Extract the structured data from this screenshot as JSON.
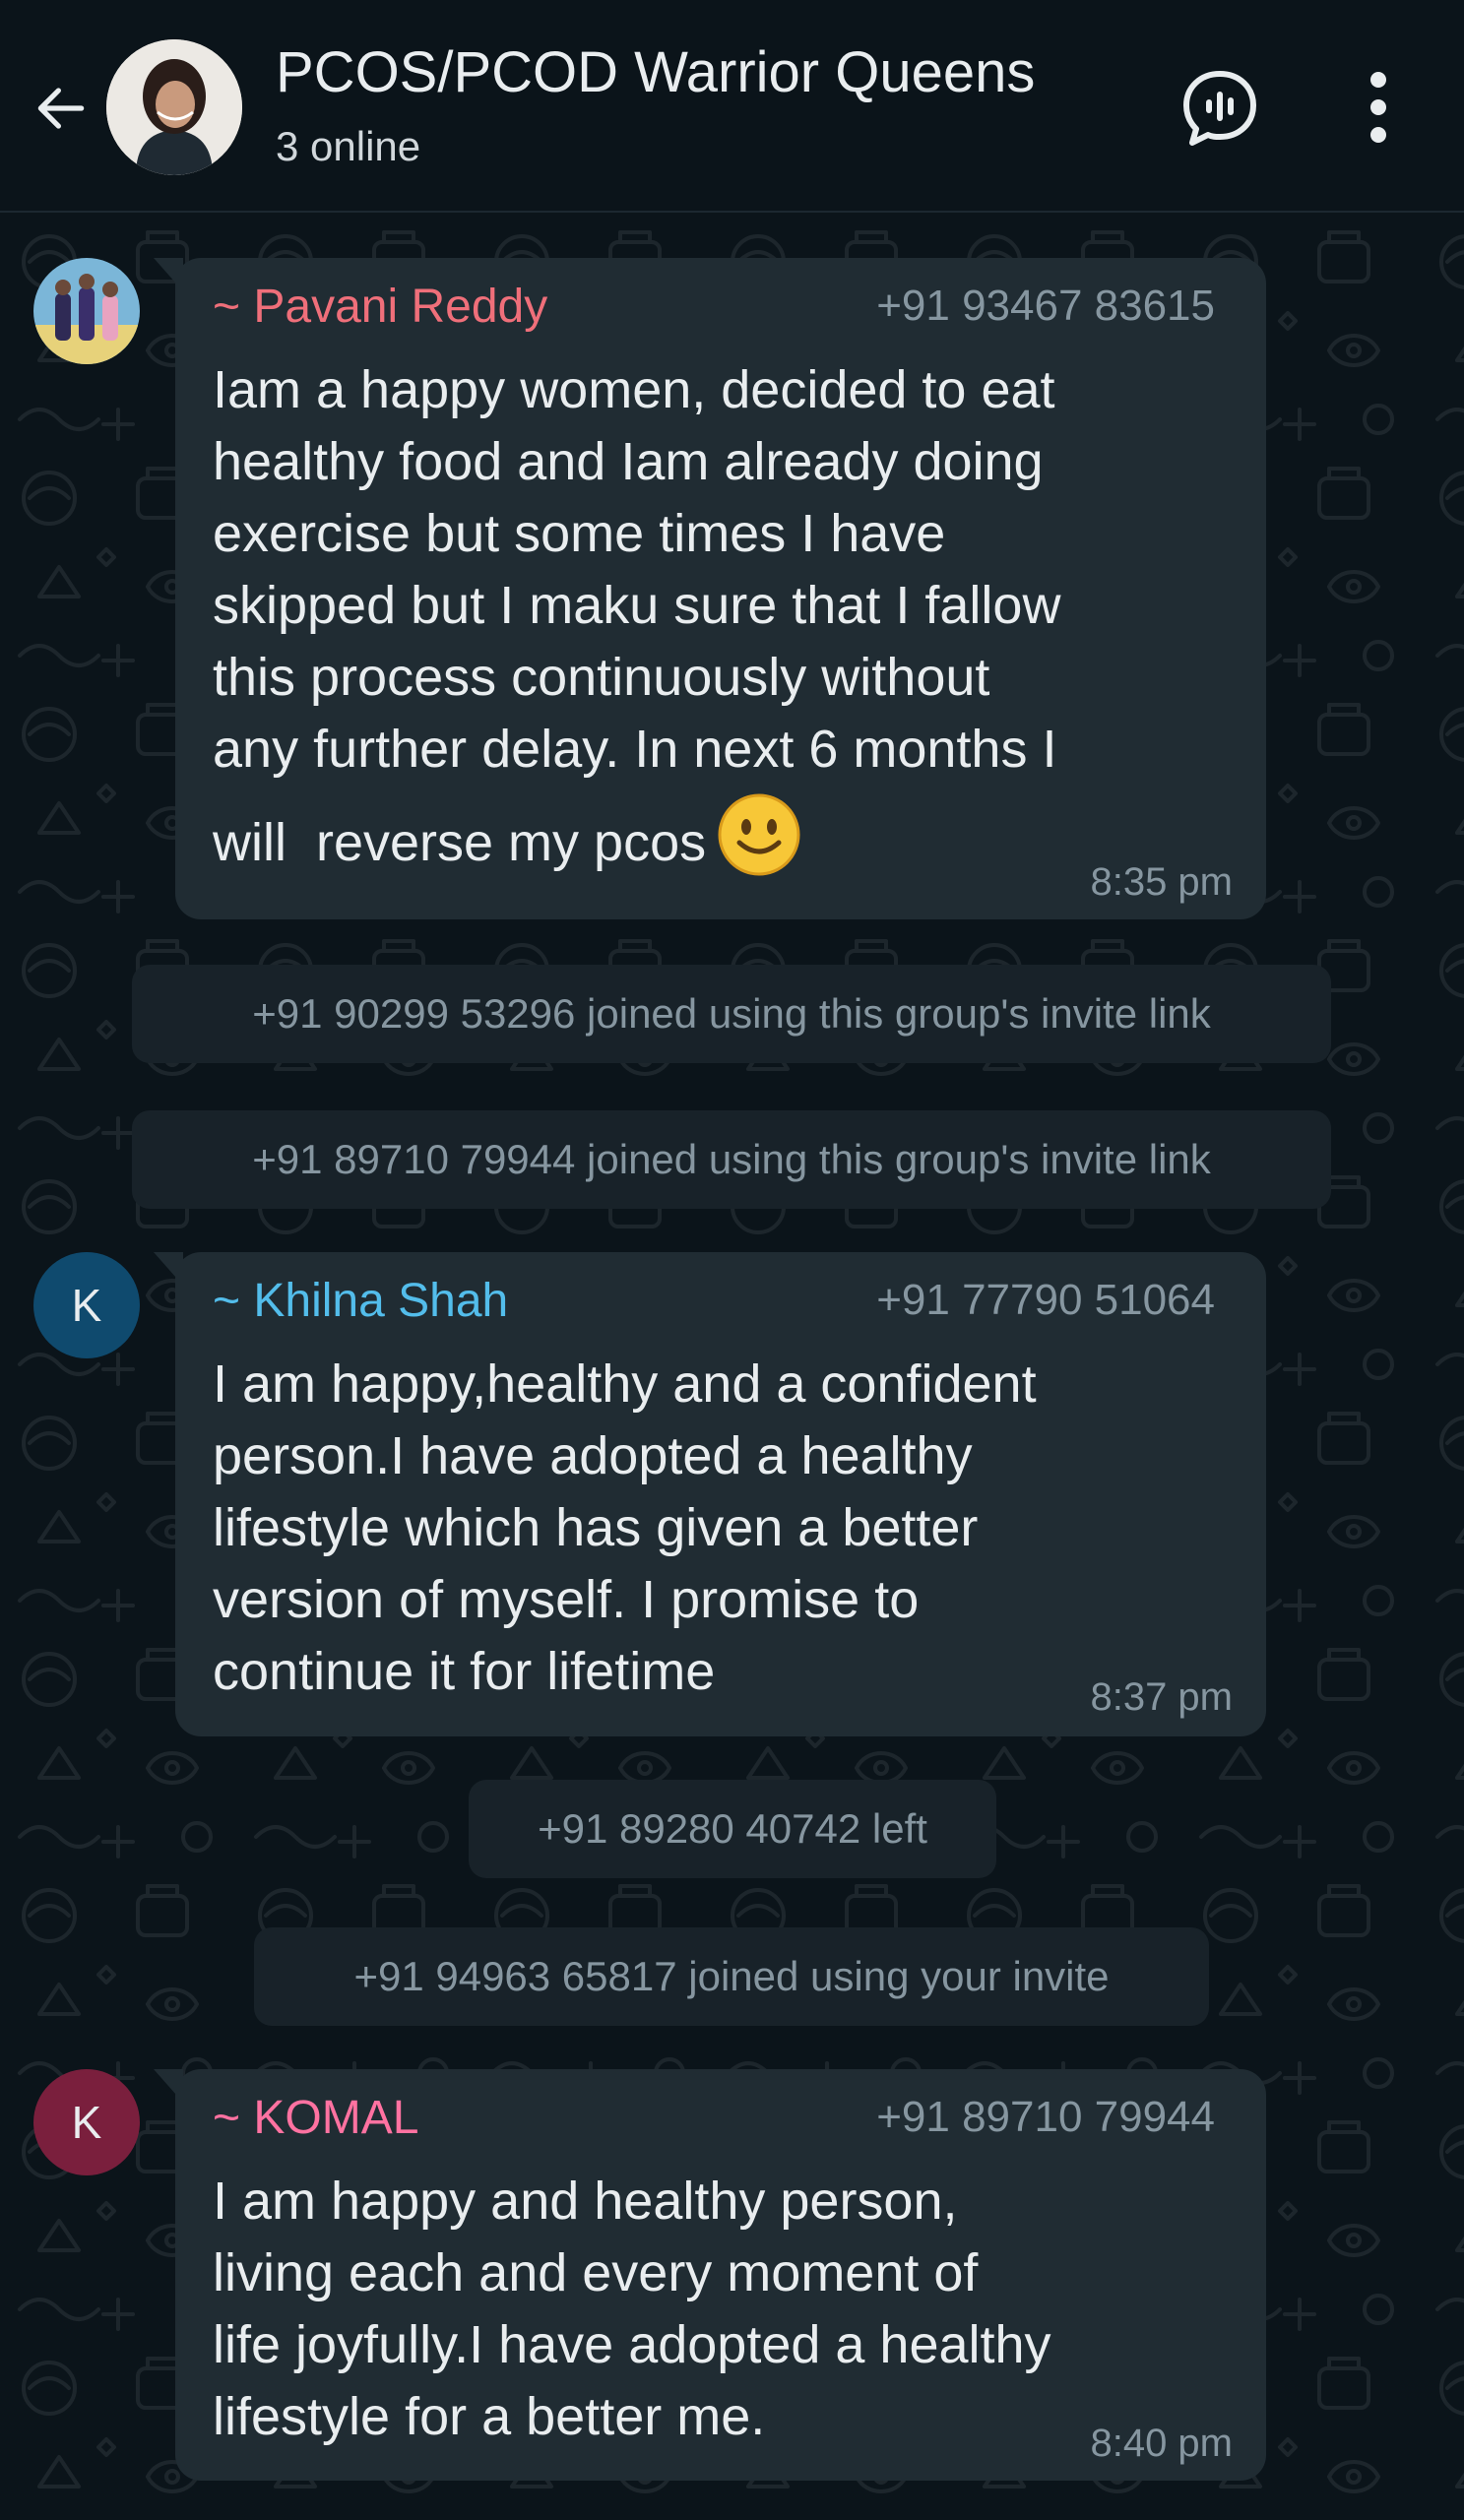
{
  "colors": {
    "background": "#0b141a",
    "bubble": "#202c33",
    "system_pill": "#182229",
    "sender_pavani": "#ef6f7a",
    "sender_khilna": "#53bdeb",
    "sender_komal": "#ff72a1",
    "avatar_k1": "#0f4a6e",
    "avatar_k2": "#7a1f3d"
  },
  "header": {
    "back_icon": "arrow-left-icon",
    "title": "PCOS/PCOD Warrior Queens",
    "subtitle": "3 online",
    "voice_chat_icon": "voice-chat-icon",
    "menu_icon": "more-vertical-icon"
  },
  "messages": [
    {
      "sender": "~ Pavani Reddy",
      "phone": "+91 93467 83615",
      "lines": [
        "Iam a happy women, decided to eat",
        "healthy food and Iam already doing",
        "exercise but some times I have",
        "skipped but I maku sure that I fallow",
        "this process continuously without",
        "any further delay. In next 6 months I",
        "will  reverse my pcos"
      ],
      "emoji": "smiling-face-icon",
      "time": "8:35 pm"
    },
    {
      "sender": "~ Khilna Shah",
      "phone": "+91 77790 51064",
      "avatar_letter": "K",
      "lines": [
        "I am happy,healthy and a confident",
        "person.I have adopted a healthy",
        "lifestyle which has given a better",
        "version of myself. I promise to",
        "continue it for lifetime"
      ],
      "time": "8:37 pm"
    },
    {
      "sender": "~ KOMAL",
      "phone": "+91 89710 79944",
      "avatar_letter": "K",
      "lines": [
        "I am happy and healthy person,",
        "living each and every moment of",
        "life joyfully.I have adopted a healthy",
        "lifestyle for a better me."
      ],
      "time": "8:40 pm"
    }
  ],
  "system_messages": [
    "+91 90299 53296 joined using this group's invite link",
    "+91 89710 79944 joined using this group's invite link",
    "+91 89280 40742 left",
    "+91 94963 65817 joined using your invite"
  ]
}
